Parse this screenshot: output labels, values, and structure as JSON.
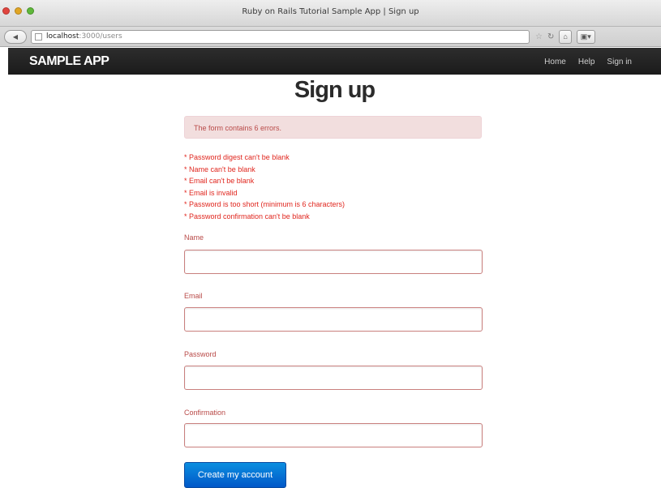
{
  "window": {
    "title": "Ruby on Rails Tutorial Sample App | Sign up"
  },
  "address_bar": {
    "host": "localhost",
    "path": ":3000/users"
  },
  "navbar": {
    "brand": "SAMPLE APP",
    "links": [
      "Home",
      "Help",
      "Sign in"
    ]
  },
  "page": {
    "title": "Sign up"
  },
  "alert": {
    "text": "The form contains 6 errors."
  },
  "errors": [
    "* Password digest can't be blank",
    "* Name can't be blank",
    "* Email can't be blank",
    "* Email is invalid",
    "* Password is too short (minimum is 6 characters)",
    "* Password confirmation can't be blank"
  ],
  "form": {
    "name_label": "Name",
    "name_value": "",
    "email_label": "Email",
    "email_value": "",
    "password_label": "Password",
    "password_value": "",
    "confirmation_label": "Confirmation",
    "confirmation_value": "",
    "submit_label": "Create my account"
  },
  "icons": {
    "back": "back-arrow-icon",
    "page": "page-icon",
    "bookmark": "star-icon",
    "reload": "reload-icon",
    "home": "home-icon",
    "tabs": "tabs-icon"
  },
  "colors": {
    "navbar": "#222222",
    "error_text": "#e0261e",
    "alert_bg": "#f2dede",
    "label": "#b94a48",
    "button": "#0166cc"
  }
}
